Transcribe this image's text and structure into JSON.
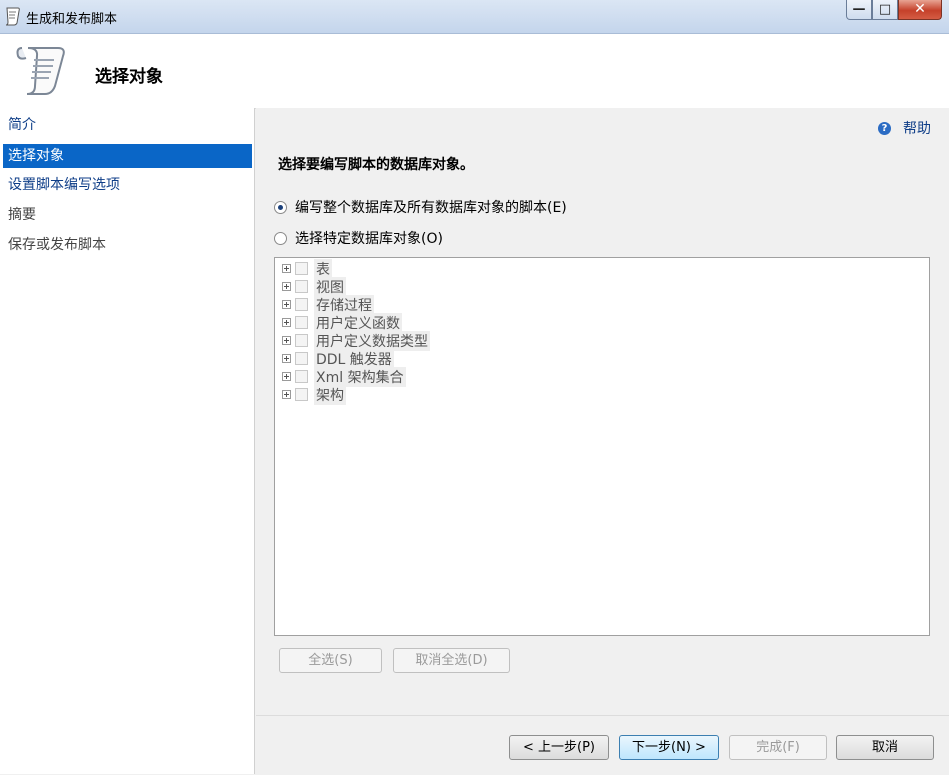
{
  "window": {
    "title": "生成和发布脚本",
    "min_glyph": "—",
    "max_glyph": "□",
    "close_glyph": "✕"
  },
  "header": {
    "title": "选择对象"
  },
  "nav": {
    "items": [
      {
        "label": "简介"
      },
      {
        "label": "选择对象"
      },
      {
        "label": "设置脚本编写选项"
      },
      {
        "label": "摘要"
      },
      {
        "label": "保存或发布脚本"
      }
    ]
  },
  "main": {
    "help_label": "帮助",
    "prompt": "选择要编写脚本的数据库对象。",
    "option_all": "编写整个数据库及所有数据库对象的脚本(E)",
    "option_specific": "选择特定数据库对象(O)",
    "tree_items": [
      {
        "label": "表"
      },
      {
        "label": "视图"
      },
      {
        "label": "存储过程"
      },
      {
        "label": "用户定义函数"
      },
      {
        "label": "用户定义数据类型"
      },
      {
        "label": "DDL 触发器"
      },
      {
        "label": "Xml 架构集合"
      },
      {
        "label": "架构"
      }
    ],
    "select_all": "全选(S)",
    "deselect_all": "取消全选(D)"
  },
  "footer": {
    "back": "< 上一步(P)",
    "next": "下一步(N) >",
    "finish": "完成(F)",
    "cancel": "取消"
  }
}
